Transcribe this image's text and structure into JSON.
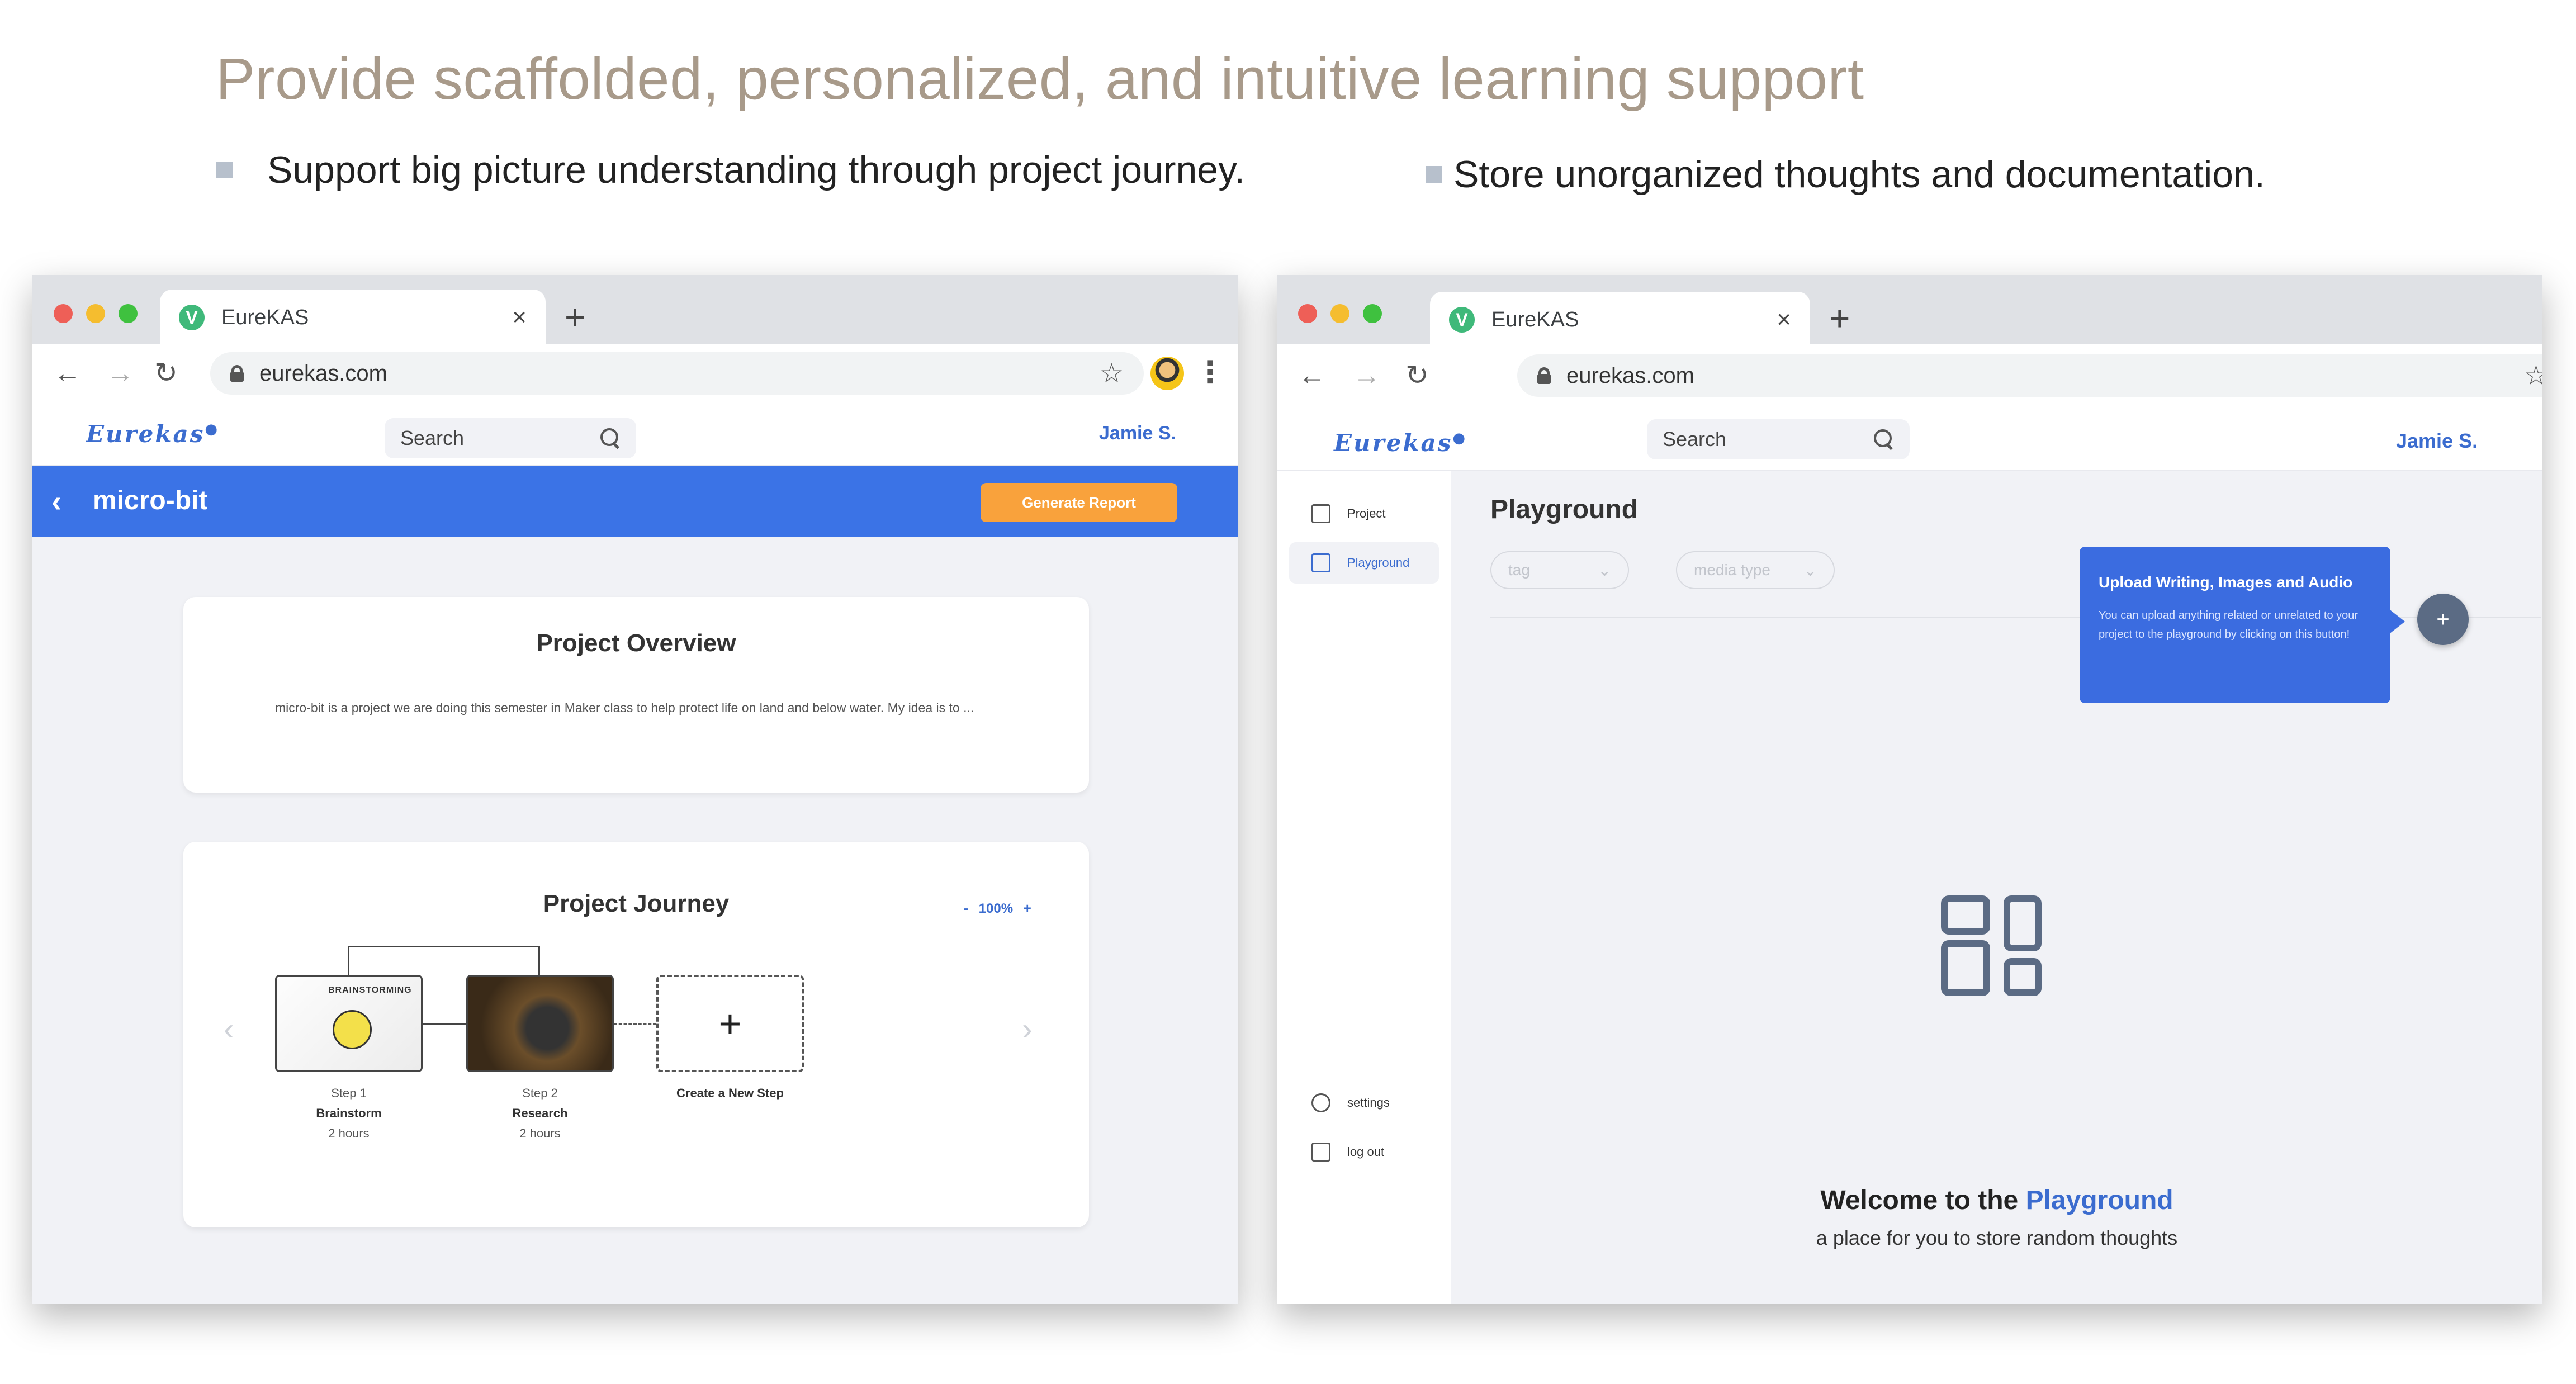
{
  "headline": "Provide scaffolded, personalized, and intuitive learning support",
  "bullets": [
    "Support big picture understanding through project journey.",
    "Store unorganized thoughts and documentation."
  ],
  "browser": {
    "tab_title": "EureKAS",
    "tab_favicon_letter": "V",
    "tab_close": "×",
    "new_tab": "+",
    "url": "eurekas.com"
  },
  "app": {
    "logo": "Eurekas",
    "search_placeholder": "Search",
    "user": "Jamie S."
  },
  "left": {
    "project_title": "micro-bit",
    "generate_button": "Generate Report",
    "overview_title": "Project Overview",
    "overview_text": "micro-bit is a project we are doing this semester in Maker class to help protect life on land and below water. My idea is to ...",
    "journey_title": "Project Journey",
    "zoom": "-  100%  +",
    "brainstorm_img_label": "BRAINSTORMING",
    "steps": [
      {
        "step": "Step 1",
        "name": "Brainstorm",
        "time": "2 hours"
      },
      {
        "step": "Step 2",
        "name": "Research",
        "time": "2 hours"
      }
    ],
    "new_step_label": "Create a New Step",
    "new_step_plus": "+"
  },
  "right": {
    "sidebar": {
      "project": "Project",
      "playground": "Playground",
      "settings": "settings",
      "logout": "log out"
    },
    "page_title": "Playground",
    "filters": [
      "tag",
      "media type"
    ],
    "tooltip_title": "Upload Writing, Images and Audio",
    "tooltip_body": "You can upload anything related or unrelated to your project to the playground by clicking on this button!",
    "fab": "+",
    "welcome_prefix": "Welcome to the ",
    "welcome_highlight": "Playground",
    "welcome_sub": "a place for you to store random thoughts"
  },
  "colors": {
    "accent_blue": "#3b73e6",
    "generate_orange": "#f9a23c",
    "headline_tan": "#a89a8a"
  }
}
